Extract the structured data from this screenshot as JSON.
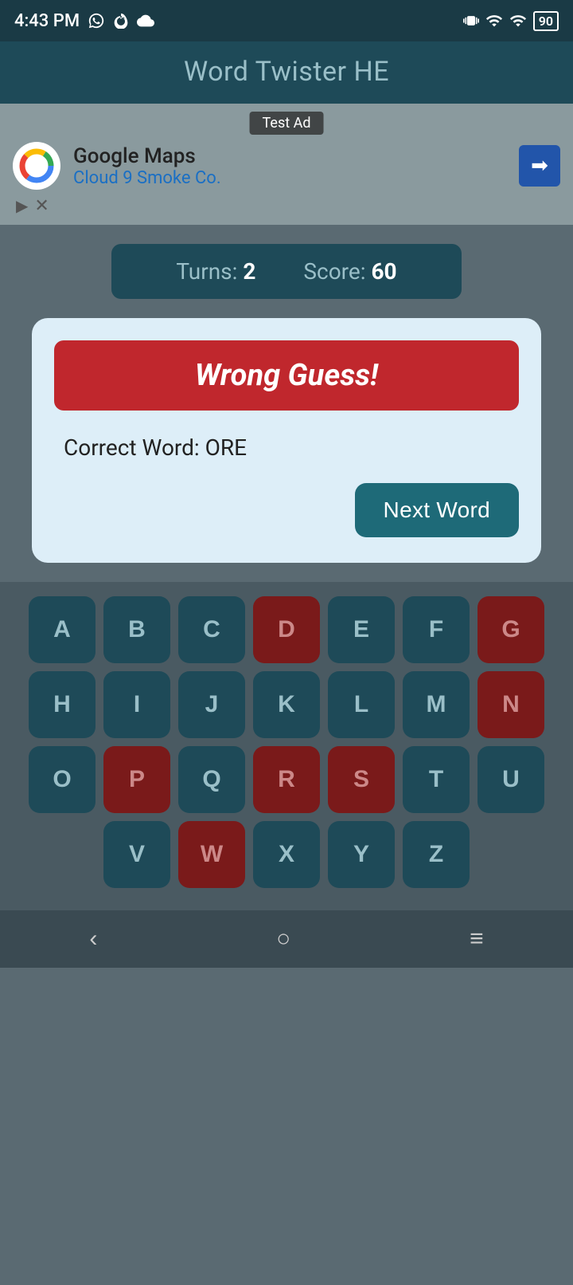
{
  "statusBar": {
    "time": "4:43 PM",
    "battery": "90"
  },
  "header": {
    "title": "Word Twister HE"
  },
  "ad": {
    "label": "Test Ad",
    "company": "Google Maps",
    "subtext": "Cloud 9 Smoke Co."
  },
  "scoreBar": {
    "turnsLabel": "Turns:",
    "turnsValue": "2",
    "scoreLabel": "Score:",
    "scoreValue": "60"
  },
  "dialog": {
    "wrongGuessText": "Wrong Guess!",
    "correctWordLabel": "Correct Word: ORE",
    "nextWordLabel": "Next Word"
  },
  "keyboard": {
    "rows": [
      [
        "A",
        "B",
        "C",
        "D",
        "E",
        "F",
        "G"
      ],
      [
        "H",
        "I",
        "J",
        "K",
        "L",
        "M",
        "N"
      ],
      [
        "O",
        "P",
        "Q",
        "R",
        "S",
        "T",
        "U"
      ],
      [
        "V",
        "W",
        "X",
        "Y",
        "Z"
      ]
    ],
    "usedKeys": [
      "D",
      "G",
      "N",
      "P",
      "R",
      "S",
      "W"
    ]
  },
  "bottomNav": {
    "backLabel": "<",
    "homeLabel": "○",
    "menuLabel": "≡"
  }
}
